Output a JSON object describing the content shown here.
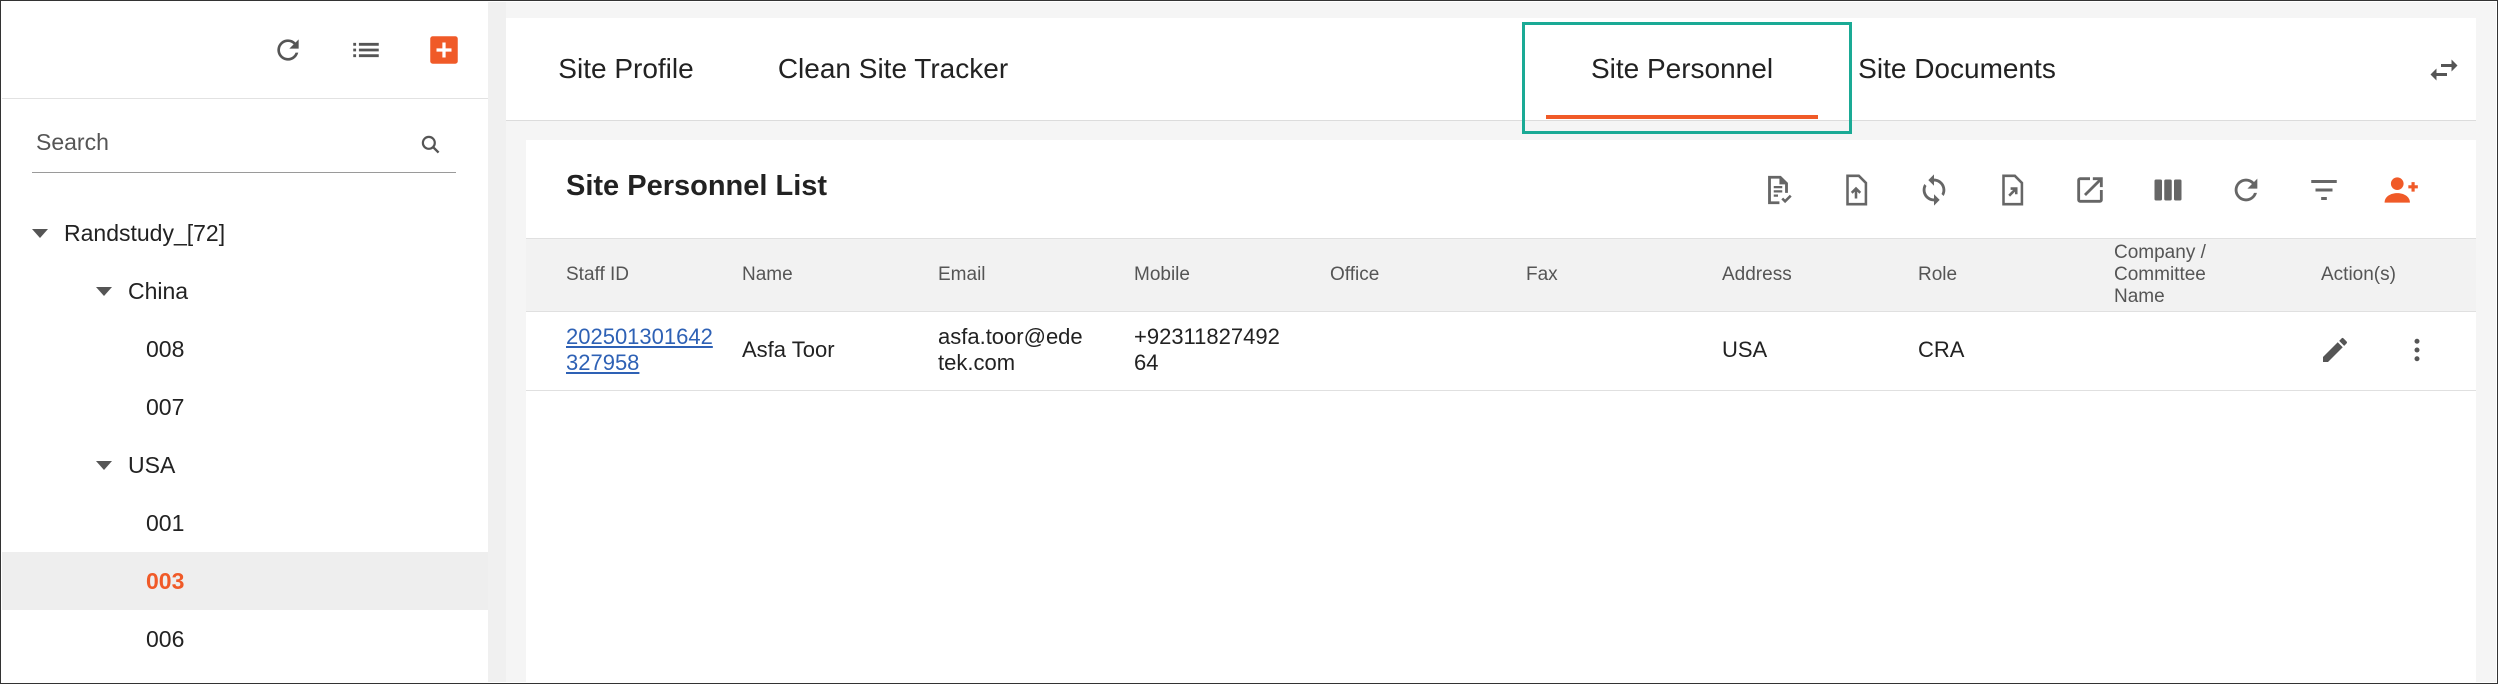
{
  "sidebar": {
    "search_placeholder": "Search",
    "tree": [
      {
        "label": "Randstudy_[72]",
        "level": 0,
        "expanded": true
      },
      {
        "label": "China",
        "level": 1,
        "expanded": true
      },
      {
        "label": "008",
        "level": 2
      },
      {
        "label": "007",
        "level": 2
      },
      {
        "label": "USA",
        "level": 1,
        "expanded": true
      },
      {
        "label": "001",
        "level": 2
      },
      {
        "label": "003",
        "level": 2,
        "selected": true
      },
      {
        "label": "006",
        "level": 2
      }
    ]
  },
  "tabs": [
    "Site Profile",
    "Clean Site Tracker",
    "Site Personnel",
    "Site Documents"
  ],
  "active_tab": "Site Personnel",
  "card": {
    "title": "Site Personnel List"
  },
  "table": {
    "headers": [
      "Staff ID",
      "Name",
      "Email",
      "Mobile",
      "Office",
      "Fax",
      "Address",
      "Role",
      "Company / Committee Name",
      "Action(s)"
    ],
    "rows": [
      {
        "staff_id": "202501301642327958",
        "name": "Asfa Toor",
        "email": "asfa.toor@edetek.com",
        "mobile": "+9231182749264",
        "office": "",
        "fax": "",
        "address": "USA",
        "role": "CRA",
        "company": ""
      }
    ]
  },
  "colors": {
    "accent": "#f05a28",
    "highlight": "#1aaa95",
    "link": "#2e61b5"
  }
}
